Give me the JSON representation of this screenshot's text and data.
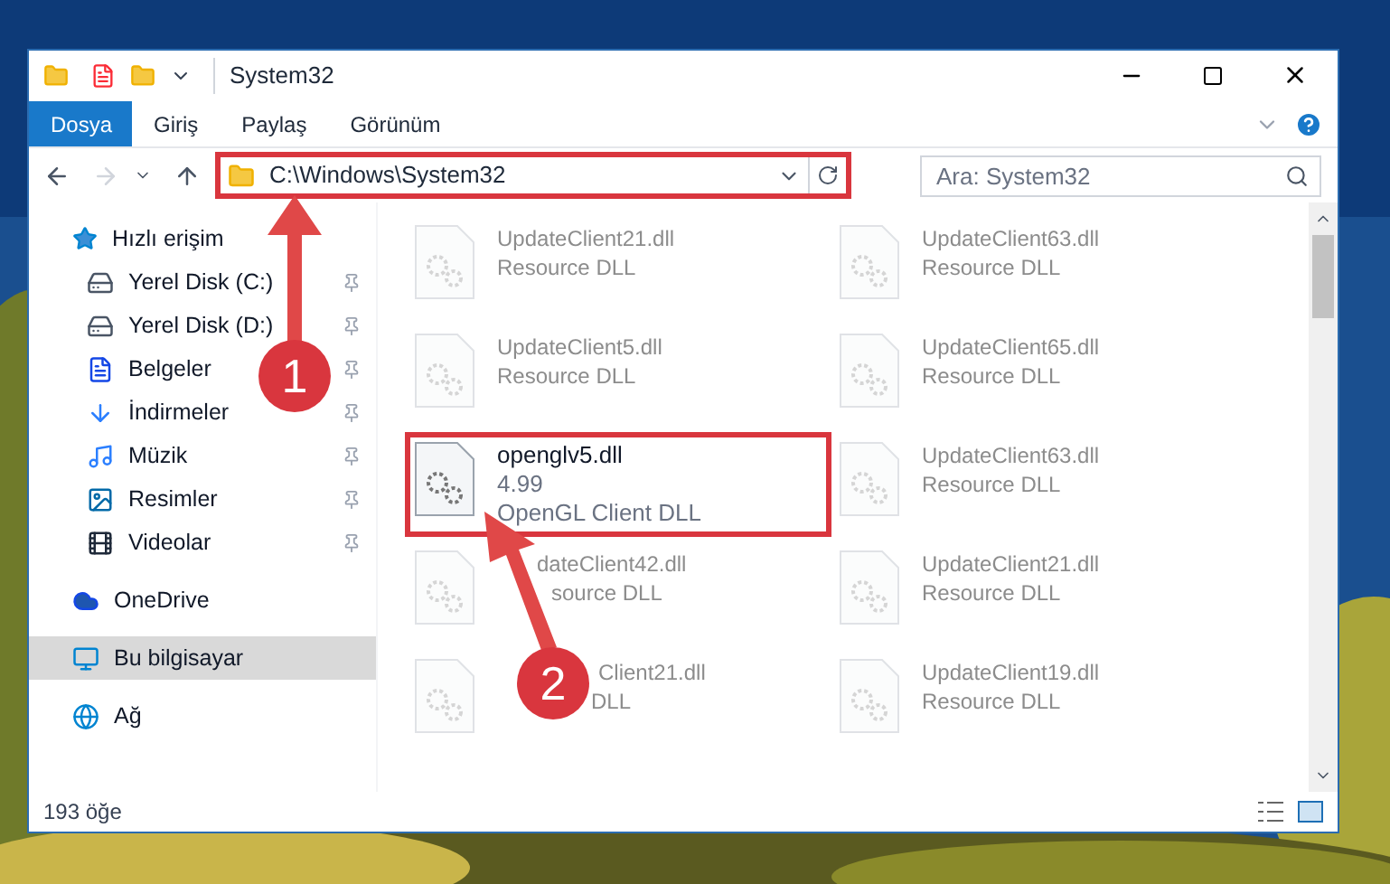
{
  "window": {
    "title": "System32"
  },
  "ribbon_tabs": [
    {
      "label": "Dosya",
      "kind": "file"
    },
    {
      "label": "Giriş",
      "kind": "tab"
    },
    {
      "label": "Paylaş",
      "kind": "tab"
    },
    {
      "label": "Görünüm",
      "kind": "tab"
    }
  ],
  "address": {
    "path": "C:\\Windows\\System32",
    "highlighted": true
  },
  "search": {
    "placeholder": "Ara: System32"
  },
  "sidebar": {
    "items": [
      {
        "label": "Hızlı erişim",
        "selected": false,
        "children": [
          {
            "label": "Yerel Disk (C:)",
            "pinned": true
          },
          {
            "label": "Yerel Disk (D:)",
            "pinned": true
          },
          {
            "label": "Belgeler",
            "pinned": true
          },
          {
            "label": "İndirmeler",
            "pinned": true
          },
          {
            "label": "Müzik",
            "pinned": true
          },
          {
            "label": "Resimler",
            "pinned": true
          },
          {
            "label": "Videolar",
            "pinned": true
          }
        ]
      },
      {
        "label": "OneDrive",
        "selected": false
      },
      {
        "label": "Bu bilgisayar",
        "selected": true
      },
      {
        "label": "Ağ",
        "selected": false
      }
    ]
  },
  "files": [
    {
      "name": "UpdateClient21.dll",
      "description": "Resource DLL",
      "faded": true,
      "highlighted": false
    },
    {
      "name": "UpdateClient63.dll",
      "description": "Resource DLL",
      "faded": true,
      "highlighted": false
    },
    {
      "name": "UpdateClient5.dll",
      "description": "Resource DLL",
      "faded": true,
      "highlighted": false
    },
    {
      "name": "UpdateClient65.dll",
      "description": "Resource DLL",
      "faded": true,
      "highlighted": false
    },
    {
      "name": "openglv5.dll",
      "version": "4.99",
      "description": "OpenGL Client DLL",
      "faded": false,
      "highlighted": true
    },
    {
      "name": "UpdateClient63.dll",
      "description": "Resource DLL",
      "faded": true,
      "highlighted": false
    },
    {
      "name": "dateClient42.dll",
      "description": "source DLL",
      "faded": true,
      "highlighted": false,
      "covered": true
    },
    {
      "name": "UpdateClient21.dll",
      "description": "Resource DLL",
      "faded": true,
      "highlighted": false
    },
    {
      "name": "Client21.dll",
      "description": "DLL",
      "faded": true,
      "highlighted": false,
      "covered": true
    },
    {
      "name": "UpdateClient19.dll",
      "description": "Resource DLL",
      "faded": true,
      "highlighted": false
    }
  ],
  "status_bar": {
    "count": "193 öğe"
  },
  "annotations": [
    {
      "label": "1"
    },
    {
      "label": "2"
    }
  ]
}
